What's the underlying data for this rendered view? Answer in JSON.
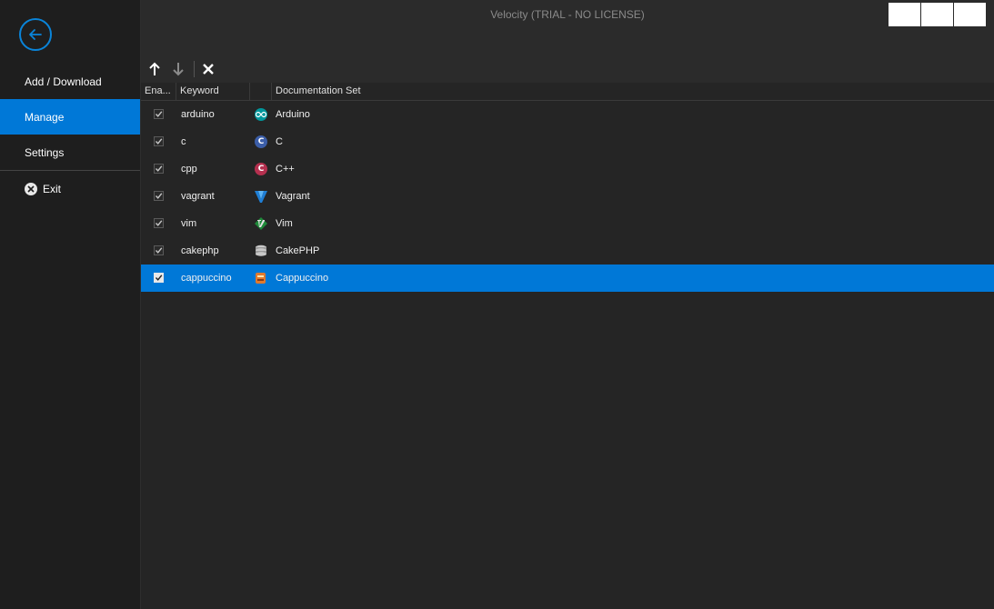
{
  "window": {
    "title": "Velocity (TRIAL - NO LICENSE)"
  },
  "sidebar": {
    "items": [
      {
        "label": "Add / Download",
        "active": false
      },
      {
        "label": "Manage",
        "active": true
      },
      {
        "label": "Settings",
        "active": false
      }
    ],
    "exit_label": "Exit"
  },
  "toolbar": {
    "buttons": [
      "arrow-up-icon",
      "arrow-down-icon",
      "close-icon"
    ]
  },
  "table": {
    "columns": [
      "Ena...",
      "Keyword",
      "",
      "Documentation Set"
    ],
    "rows": [
      {
        "enabled": true,
        "keyword": "arduino",
        "icon": "arduino-icon",
        "docset": "Arduino"
      },
      {
        "enabled": true,
        "keyword": "c",
        "icon": "c-icon",
        "docset": "C"
      },
      {
        "enabled": true,
        "keyword": "cpp",
        "icon": "cpp-icon",
        "docset": "C++"
      },
      {
        "enabled": true,
        "keyword": "vagrant",
        "icon": "vagrant-icon",
        "docset": "Vagrant"
      },
      {
        "enabled": true,
        "keyword": "vim",
        "icon": "vim-icon",
        "docset": "Vim"
      },
      {
        "enabled": true,
        "keyword": "cakephp",
        "icon": "cakephp-icon",
        "docset": "CakePHP"
      },
      {
        "enabled": true,
        "keyword": "cappuccino",
        "icon": "cappuccino-icon",
        "docset": "Cappuccino",
        "selected": true
      }
    ]
  },
  "colors": {
    "accent": "#0078d7",
    "sidebar_bg": "#1e1e1e",
    "content_bg": "#252525",
    "titlebar_bg": "#2b2b2b"
  }
}
